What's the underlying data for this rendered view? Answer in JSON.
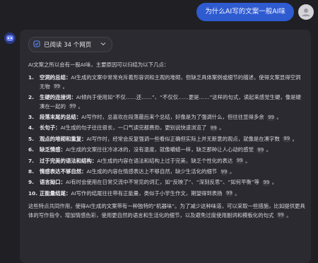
{
  "user": {
    "question": "为什么AI写的文案一般AI味"
  },
  "answer": {
    "read_status": "已阅读 34 个网页",
    "intro": "AI文案之所以会有一股AI味，主要原因可以归结为以下几点：",
    "points": [
      {
        "num": "1.",
        "term": "空洞的总结：",
        "text": "AI生成的文案中常常充斥着形容词和主观的堆砌，但缺乏具体案例或细节的描述，使得文案显得空洞无物"
      },
      {
        "num": "2.",
        "term": "生硬的连接词：",
        "text": "AI倾向于使用如“不仅……还……”、“不仅仅……更是……”这样的句式，读起来感觉生硬，像是硬凑在一起的"
      },
      {
        "num": "3.",
        "term": "段落末尾的总结：",
        "text": "AI写作时，总喜欢在段落最后来个总结，好像是为了强调什么，但往往显得多余"
      },
      {
        "num": "4.",
        "term": "长句子：",
        "text": "AI生成的句子往往很长，一口气读完都费劲，更别说快速浏览了"
      },
      {
        "num": "5.",
        "term": "观点的堆砌和重复：",
        "text": "AI写作时，经常会反复强调一些看似正确但实际上并无新意的观点，就像是在凑字数"
      },
      {
        "num": "6.",
        "term": "缺乏情感：",
        "text": "AI生成的文案往往冷冰冰的，没有温度，就像嚼蜡一样，缺乏那种让人心动的感觉"
      },
      {
        "num": "7.",
        "term": "过于完美的语法和结构：",
        "text": "AI生成的内容在语法和结构上过于完美，缺乏个性化的表达"
      },
      {
        "num": "8.",
        "term": "情感表达不够自然：",
        "text": "AI生成的内容在情感表达上不够自然，缺少生活化的细节"
      },
      {
        "num": "9.",
        "term": "语言拗口：",
        "text": "AI有时会使用在日常交流中不常见的词汇，如“反映了”、“深刻反思”、“如何平衡”等"
      },
      {
        "num": "10.",
        "term": "正能量结尾：",
        "text": "AI写作的结尾往往带有正能量，类似于小学生作文，期望得到表扬"
      }
    ],
    "conclusion": "这些特点共同作用，使得AI生成的文案带有一种独特的“机器味”。为了减少这种味道，可以采取一些措施，比如提供更具体的写作指令，增加情感色彩，使用更自然的语言和生活化的细节，以及避免过度使用副词和模板化的句式",
    "citation_mark": "99",
    "colors": {
      "user_bubble": "#2f5bd0",
      "card": "#2a2a30",
      "background": "#202024"
    },
    "icons": {
      "bot": "bot-face-icon",
      "user": "user-avatar-icon",
      "read": "checklist-icon",
      "expand": "chevron-down-icon"
    }
  }
}
